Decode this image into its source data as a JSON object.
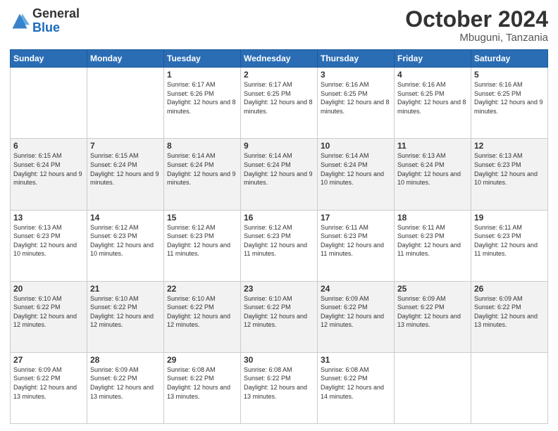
{
  "logo": {
    "general": "General",
    "blue": "Blue"
  },
  "header": {
    "month": "October 2024",
    "location": "Mbuguni, Tanzania"
  },
  "weekdays": [
    "Sunday",
    "Monday",
    "Tuesday",
    "Wednesday",
    "Thursday",
    "Friday",
    "Saturday"
  ],
  "weeks": [
    [
      {
        "day": "",
        "sunrise": "",
        "sunset": "",
        "daylight": ""
      },
      {
        "day": "",
        "sunrise": "",
        "sunset": "",
        "daylight": ""
      },
      {
        "day": "1",
        "sunrise": "Sunrise: 6:17 AM",
        "sunset": "Sunset: 6:26 PM",
        "daylight": "Daylight: 12 hours and 8 minutes."
      },
      {
        "day": "2",
        "sunrise": "Sunrise: 6:17 AM",
        "sunset": "Sunset: 6:25 PM",
        "daylight": "Daylight: 12 hours and 8 minutes."
      },
      {
        "day": "3",
        "sunrise": "Sunrise: 6:16 AM",
        "sunset": "Sunset: 6:25 PM",
        "daylight": "Daylight: 12 hours and 8 minutes."
      },
      {
        "day": "4",
        "sunrise": "Sunrise: 6:16 AM",
        "sunset": "Sunset: 6:25 PM",
        "daylight": "Daylight: 12 hours and 8 minutes."
      },
      {
        "day": "5",
        "sunrise": "Sunrise: 6:16 AM",
        "sunset": "Sunset: 6:25 PM",
        "daylight": "Daylight: 12 hours and 9 minutes."
      }
    ],
    [
      {
        "day": "6",
        "sunrise": "Sunrise: 6:15 AM",
        "sunset": "Sunset: 6:24 PM",
        "daylight": "Daylight: 12 hours and 9 minutes."
      },
      {
        "day": "7",
        "sunrise": "Sunrise: 6:15 AM",
        "sunset": "Sunset: 6:24 PM",
        "daylight": "Daylight: 12 hours and 9 minutes."
      },
      {
        "day": "8",
        "sunrise": "Sunrise: 6:14 AM",
        "sunset": "Sunset: 6:24 PM",
        "daylight": "Daylight: 12 hours and 9 minutes."
      },
      {
        "day": "9",
        "sunrise": "Sunrise: 6:14 AM",
        "sunset": "Sunset: 6:24 PM",
        "daylight": "Daylight: 12 hours and 9 minutes."
      },
      {
        "day": "10",
        "sunrise": "Sunrise: 6:14 AM",
        "sunset": "Sunset: 6:24 PM",
        "daylight": "Daylight: 12 hours and 10 minutes."
      },
      {
        "day": "11",
        "sunrise": "Sunrise: 6:13 AM",
        "sunset": "Sunset: 6:24 PM",
        "daylight": "Daylight: 12 hours and 10 minutes."
      },
      {
        "day": "12",
        "sunrise": "Sunrise: 6:13 AM",
        "sunset": "Sunset: 6:23 PM",
        "daylight": "Daylight: 12 hours and 10 minutes."
      }
    ],
    [
      {
        "day": "13",
        "sunrise": "Sunrise: 6:13 AM",
        "sunset": "Sunset: 6:23 PM",
        "daylight": "Daylight: 12 hours and 10 minutes."
      },
      {
        "day": "14",
        "sunrise": "Sunrise: 6:12 AM",
        "sunset": "Sunset: 6:23 PM",
        "daylight": "Daylight: 12 hours and 10 minutes."
      },
      {
        "day": "15",
        "sunrise": "Sunrise: 6:12 AM",
        "sunset": "Sunset: 6:23 PM",
        "daylight": "Daylight: 12 hours and 11 minutes."
      },
      {
        "day": "16",
        "sunrise": "Sunrise: 6:12 AM",
        "sunset": "Sunset: 6:23 PM",
        "daylight": "Daylight: 12 hours and 11 minutes."
      },
      {
        "day": "17",
        "sunrise": "Sunrise: 6:11 AM",
        "sunset": "Sunset: 6:23 PM",
        "daylight": "Daylight: 12 hours and 11 minutes."
      },
      {
        "day": "18",
        "sunrise": "Sunrise: 6:11 AM",
        "sunset": "Sunset: 6:23 PM",
        "daylight": "Daylight: 12 hours and 11 minutes."
      },
      {
        "day": "19",
        "sunrise": "Sunrise: 6:11 AM",
        "sunset": "Sunset: 6:23 PM",
        "daylight": "Daylight: 12 hours and 11 minutes."
      }
    ],
    [
      {
        "day": "20",
        "sunrise": "Sunrise: 6:10 AM",
        "sunset": "Sunset: 6:22 PM",
        "daylight": "Daylight: 12 hours and 12 minutes."
      },
      {
        "day": "21",
        "sunrise": "Sunrise: 6:10 AM",
        "sunset": "Sunset: 6:22 PM",
        "daylight": "Daylight: 12 hours and 12 minutes."
      },
      {
        "day": "22",
        "sunrise": "Sunrise: 6:10 AM",
        "sunset": "Sunset: 6:22 PM",
        "daylight": "Daylight: 12 hours and 12 minutes."
      },
      {
        "day": "23",
        "sunrise": "Sunrise: 6:10 AM",
        "sunset": "Sunset: 6:22 PM",
        "daylight": "Daylight: 12 hours and 12 minutes."
      },
      {
        "day": "24",
        "sunrise": "Sunrise: 6:09 AM",
        "sunset": "Sunset: 6:22 PM",
        "daylight": "Daylight: 12 hours and 12 minutes."
      },
      {
        "day": "25",
        "sunrise": "Sunrise: 6:09 AM",
        "sunset": "Sunset: 6:22 PM",
        "daylight": "Daylight: 12 hours and 13 minutes."
      },
      {
        "day": "26",
        "sunrise": "Sunrise: 6:09 AM",
        "sunset": "Sunset: 6:22 PM",
        "daylight": "Daylight: 12 hours and 13 minutes."
      }
    ],
    [
      {
        "day": "27",
        "sunrise": "Sunrise: 6:09 AM",
        "sunset": "Sunset: 6:22 PM",
        "daylight": "Daylight: 12 hours and 13 minutes."
      },
      {
        "day": "28",
        "sunrise": "Sunrise: 6:09 AM",
        "sunset": "Sunset: 6:22 PM",
        "daylight": "Daylight: 12 hours and 13 minutes."
      },
      {
        "day": "29",
        "sunrise": "Sunrise: 6:08 AM",
        "sunset": "Sunset: 6:22 PM",
        "daylight": "Daylight: 12 hours and 13 minutes."
      },
      {
        "day": "30",
        "sunrise": "Sunrise: 6:08 AM",
        "sunset": "Sunset: 6:22 PM",
        "daylight": "Daylight: 12 hours and 13 minutes."
      },
      {
        "day": "31",
        "sunrise": "Sunrise: 6:08 AM",
        "sunset": "Sunset: 6:22 PM",
        "daylight": "Daylight: 12 hours and 14 minutes."
      },
      {
        "day": "",
        "sunrise": "",
        "sunset": "",
        "daylight": ""
      },
      {
        "day": "",
        "sunrise": "",
        "sunset": "",
        "daylight": ""
      }
    ]
  ]
}
